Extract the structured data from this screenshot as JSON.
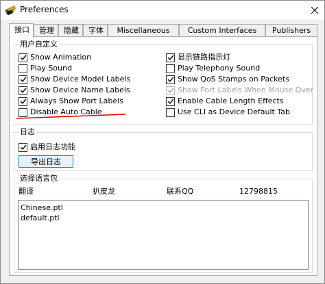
{
  "window": {
    "title": "Preferences"
  },
  "tabs": [
    {
      "label": "接口"
    },
    {
      "label": "管理"
    },
    {
      "label": "隐藏"
    },
    {
      "label": "字体"
    },
    {
      "label": "Miscellaneous"
    },
    {
      "label": "Custom Interfaces"
    },
    {
      "label": "Publishers"
    }
  ],
  "custom_group": {
    "title": "用户自定义",
    "left_options": [
      {
        "label": "Show Animation",
        "checked": true
      },
      {
        "label": "Play Sound",
        "checked": false
      },
      {
        "label": "Show Device Model Labels",
        "checked": true
      },
      {
        "label": "Show Device Name Labels",
        "checked": true
      },
      {
        "label": "Always Show Port Labels",
        "checked": true
      },
      {
        "label": "Disable Auto Cable",
        "checked": false
      }
    ],
    "right_options": [
      {
        "label": "显示链路指示灯",
        "checked": true
      },
      {
        "label": "Play Telephony Sound",
        "checked": false
      },
      {
        "label": "Show QoS Stamps on Packets",
        "checked": true
      },
      {
        "label": "Show Port Labels When Mouse Over",
        "checked": true,
        "disabled": true
      },
      {
        "label": "Enable Cable Length Effects",
        "checked": true
      },
      {
        "label": "Use CLI as Device Default Tab",
        "checked": false
      }
    ]
  },
  "log_group": {
    "title": "日志",
    "enable_label": "启用日志功能",
    "enable_checked": true,
    "export_button": "导出日志"
  },
  "language_group": {
    "title": "选择语言包",
    "info": [
      "翻译",
      "扒皮龙",
      "联系QQ",
      "12798815"
    ],
    "items": [
      "Chinese.ptl",
      "default.ptl"
    ]
  },
  "colors": {
    "accent": "#0078d7",
    "annotation": "#e00000"
  }
}
